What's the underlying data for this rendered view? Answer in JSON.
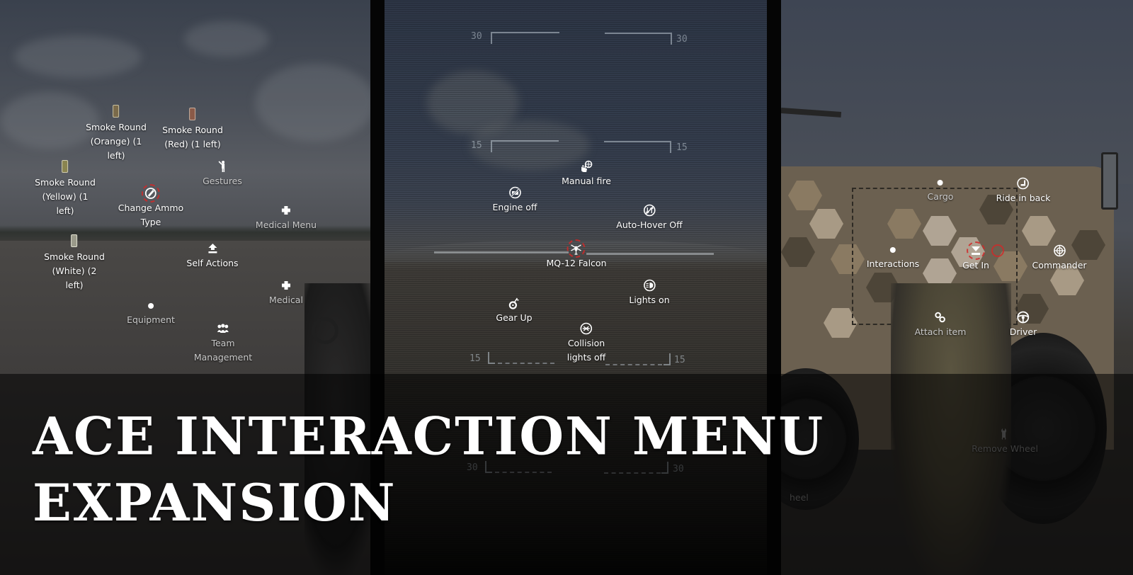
{
  "title": {
    "line1": "ACE INTERACTION MENU",
    "line2": "EXPANSION"
  },
  "left_panel": {
    "items": [
      {
        "id": "smoke-orange",
        "label": "Smoke Round (Orange) (1 left)",
        "lines": [
          "Smoke Round",
          "(Orange) (1",
          "left)"
        ],
        "icon": "smoke-grenade-icon"
      },
      {
        "id": "smoke-red",
        "label": "Smoke Round (Red) (1 left)",
        "lines": [
          "Smoke Round",
          "(Red) (1 left)"
        ],
        "icon": "smoke-grenade-icon"
      },
      {
        "id": "gestures",
        "label": "Gestures",
        "icon": "gesture-icon"
      },
      {
        "id": "smoke-yellow",
        "label": "Smoke Round (Yellow) (1 left)",
        "lines": [
          "Smoke Round",
          "(Yellow) (1",
          "left)"
        ],
        "icon": "smoke-grenade-icon"
      },
      {
        "id": "change-ammo",
        "label": "Change Ammo Type",
        "lines": [
          "Change Ammo",
          "Type"
        ],
        "icon": "ammo-icon",
        "selected": true
      },
      {
        "id": "medical-menu",
        "label": "Medical Menu",
        "icon": "medical-cross-icon"
      },
      {
        "id": "smoke-white",
        "label": "Smoke Round (White) (2 left)",
        "lines": [
          "Smoke Round",
          "(White) (2",
          "left)"
        ],
        "icon": "smoke-grenade-icon"
      },
      {
        "id": "self-actions",
        "label": "Self Actions",
        "icon": "self-actions-icon"
      },
      {
        "id": "medical",
        "label": "Medical",
        "icon": "medical-cross-icon"
      },
      {
        "id": "equipment",
        "label": "Equipment",
        "icon": "dot-icon"
      },
      {
        "id": "team-management",
        "label": "Team Management",
        "lines": [
          "Team",
          "Management"
        ],
        "icon": "team-icon"
      }
    ]
  },
  "center_panel": {
    "hud_scale": {
      "top": "30",
      "mid": "15",
      "low": "15",
      "bottom": "30"
    },
    "items": [
      {
        "id": "manual-fire",
        "label": "Manual fire",
        "icon": "manual-fire-icon"
      },
      {
        "id": "engine-off",
        "label": "Engine off",
        "icon": "engine-off-icon"
      },
      {
        "id": "auto-hover-off",
        "label": "Auto-Hover Off",
        "icon": "auto-hover-off-icon"
      },
      {
        "id": "mq12-falcon",
        "label": "MQ-12 Falcon",
        "icon": "helicopter-icon",
        "selected": true
      },
      {
        "id": "gear-up",
        "label": "Gear Up",
        "icon": "landing-gear-icon"
      },
      {
        "id": "lights-on",
        "label": "Lights on",
        "icon": "lights-icon"
      },
      {
        "id": "collision-lights-off",
        "label": "Collision lights off",
        "lines": [
          "Collision",
          "lights off"
        ],
        "icon": "collision-lights-off-icon"
      }
    ]
  },
  "right_panel": {
    "items": [
      {
        "id": "cargo",
        "label": "Cargo",
        "icon": "dot-icon"
      },
      {
        "id": "ride-in-back",
        "label": "Ride in back",
        "icon": "seat-icon"
      },
      {
        "id": "interactions",
        "label": "Interactions",
        "icon": "dot-icon"
      },
      {
        "id": "get-in",
        "label": "Get In",
        "icon": "get-in-icon",
        "selected": true
      },
      {
        "id": "commander",
        "label": "Commander",
        "icon": "commander-icon"
      },
      {
        "id": "attach-item",
        "label": "Attach item",
        "icon": "attach-icon"
      },
      {
        "id": "driver",
        "label": "Driver",
        "icon": "steering-wheel-icon"
      },
      {
        "id": "remove-wheel",
        "label": "Remove Wheel",
        "icon": "wrench-icon"
      },
      {
        "id": "wheel-partial",
        "label": "heel",
        "icon": ""
      }
    ]
  },
  "colors": {
    "selection_ring": "#d22828",
    "label_text": "#ffffff",
    "smoke_orange": "#7a6a4a",
    "smoke_red": "#8a5a48",
    "smoke_yellow": "#8a8450",
    "smoke_white": "#9a9a8a"
  }
}
